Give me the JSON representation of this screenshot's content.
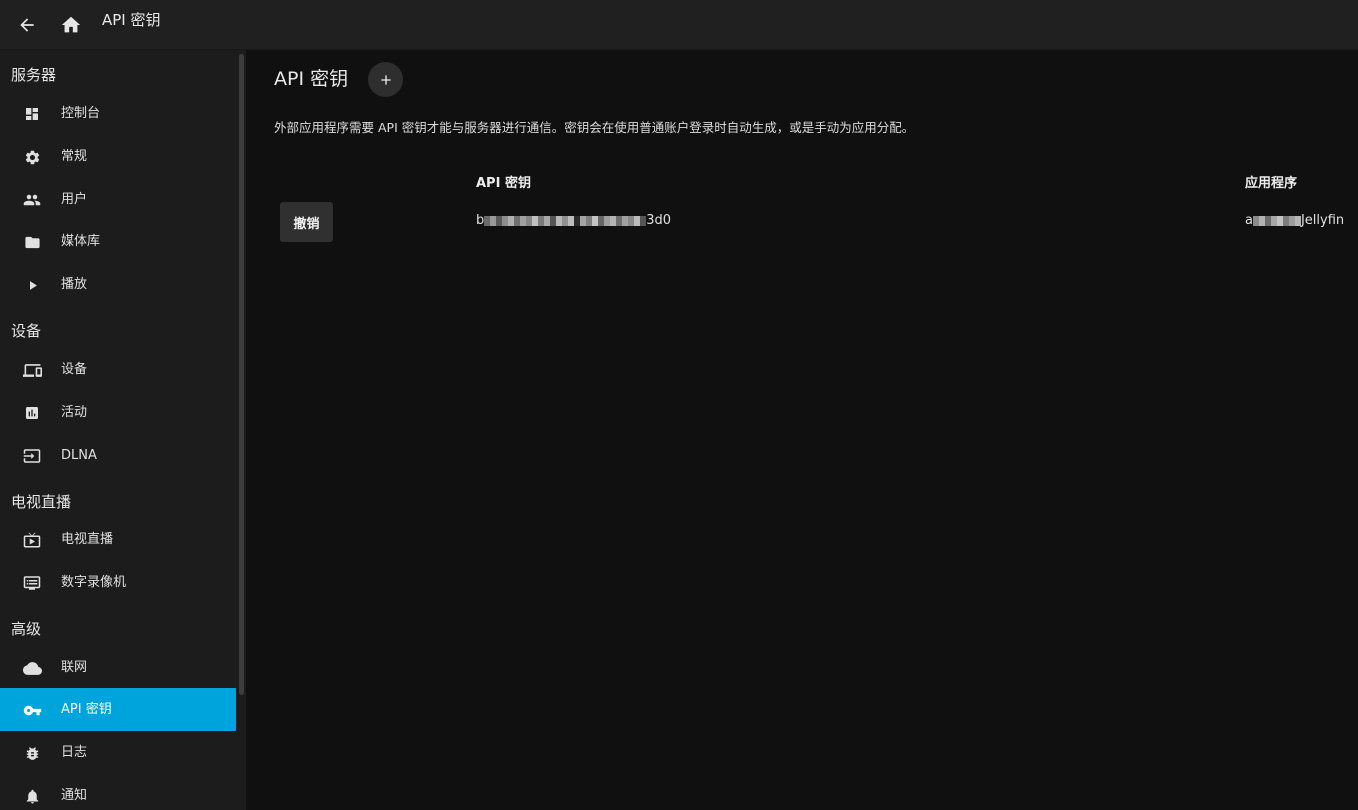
{
  "header": {
    "back_icon": "arrow-left-icon",
    "home_icon": "home-icon",
    "title": "API 密钥"
  },
  "sidebar": {
    "sections": [
      {
        "title": "服务器",
        "items": [
          {
            "label": "控制台",
            "icon": "dashboard-icon"
          },
          {
            "label": "常规",
            "icon": "gear-icon"
          },
          {
            "label": "用户",
            "icon": "people-icon"
          },
          {
            "label": "媒体库",
            "icon": "folder-icon"
          },
          {
            "label": "播放",
            "icon": "play-icon"
          }
        ]
      },
      {
        "title": "设备",
        "items": [
          {
            "label": "设备",
            "icon": "devices-icon"
          },
          {
            "label": "活动",
            "icon": "assessment-icon"
          },
          {
            "label": "DLNA",
            "icon": "input-icon"
          }
        ]
      },
      {
        "title": "电视直播",
        "items": [
          {
            "label": "电视直播",
            "icon": "live-tv-icon"
          },
          {
            "label": "数字录像机",
            "icon": "dvr-icon"
          }
        ]
      },
      {
        "title": "高级",
        "items": [
          {
            "label": "联网",
            "icon": "cloud-icon"
          },
          {
            "label": "API 密钥",
            "icon": "key-icon",
            "active": true
          },
          {
            "label": "日志",
            "icon": "bug-icon"
          },
          {
            "label": "通知",
            "icon": "bell-icon"
          }
        ]
      }
    ]
  },
  "main": {
    "title": "API 密钥",
    "add_icon": "plus-icon",
    "description": "外部应用程序需要 API 密钥才能与服务器进行通信。密钥会在使用普通账户登录时自动生成，或是手动为应用分配。",
    "table": {
      "columns": [
        "API 密钥",
        "应用程序"
      ],
      "rows": [
        {
          "action": "撤销",
          "key_start": "b",
          "key_end": "3d0",
          "app_start": "a",
          "app_end": "Jellyfin"
        }
      ]
    }
  },
  "colors": {
    "accent": "#00a4dc",
    "background": "#101010",
    "sidebar": "#1c1c1c",
    "header": "#202020"
  }
}
